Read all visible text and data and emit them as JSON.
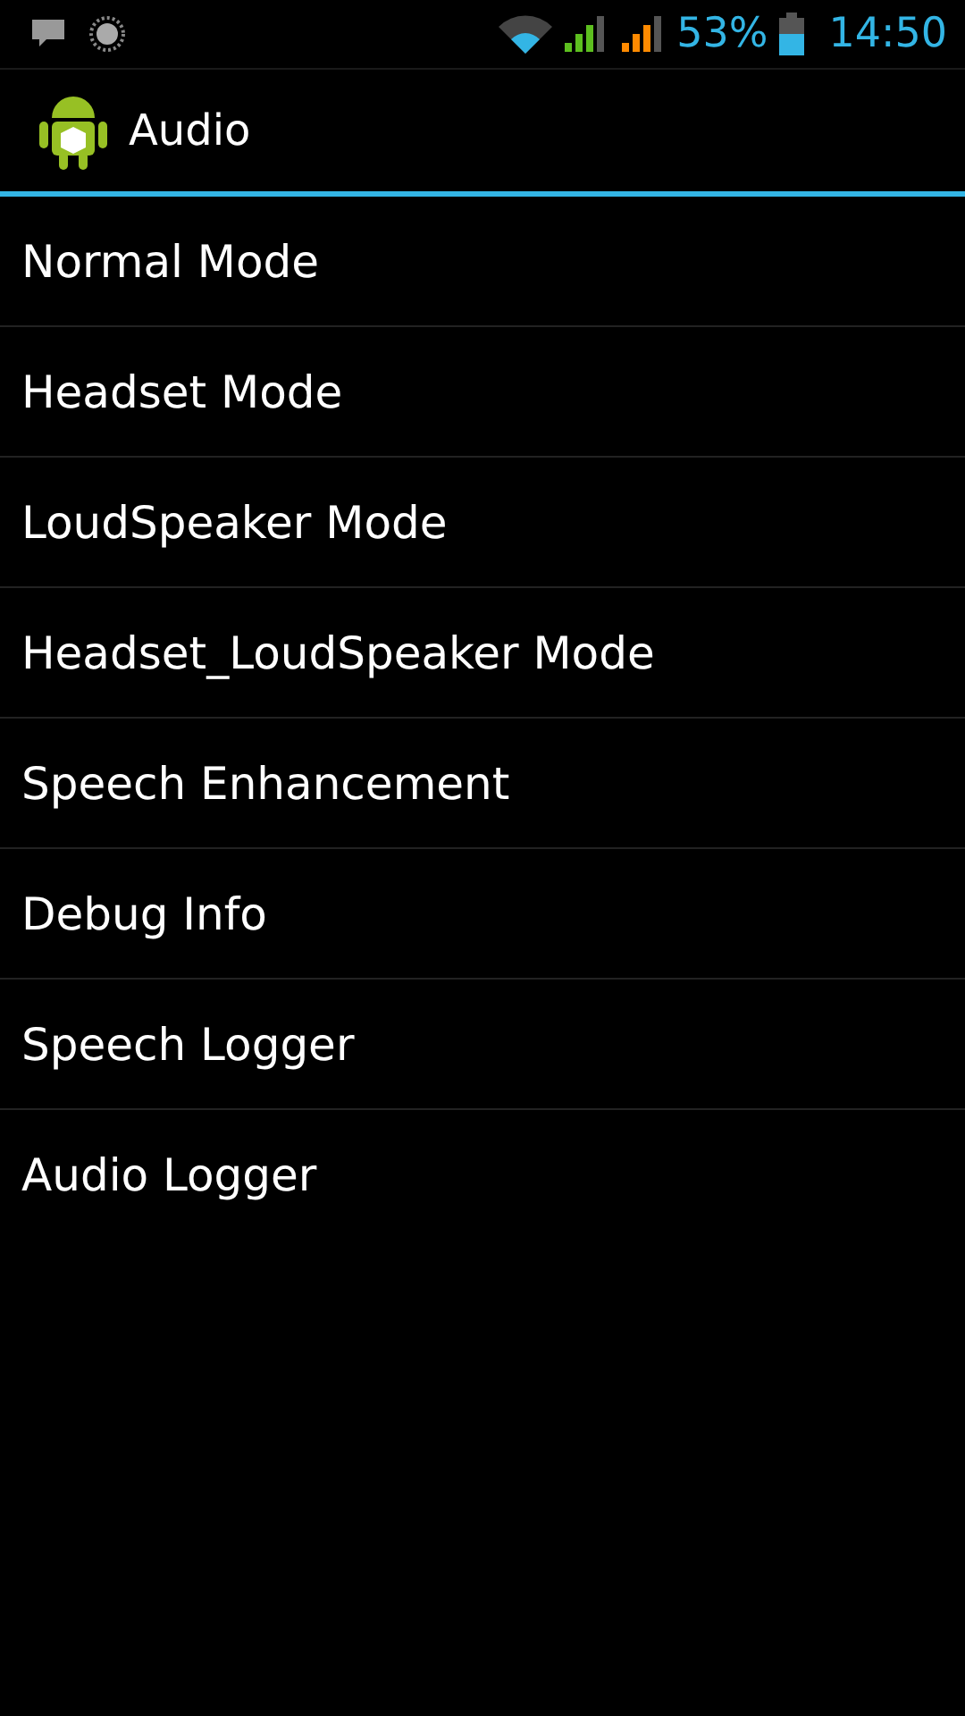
{
  "status_bar": {
    "battery": "53%",
    "time": "14:50"
  },
  "action_bar": {
    "title": "Audio"
  },
  "items": [
    {
      "label": "Normal Mode"
    },
    {
      "label": "Headset Mode"
    },
    {
      "label": "LoudSpeaker Mode"
    },
    {
      "label": "Headset_LoudSpeaker Mode"
    },
    {
      "label": "Speech Enhancement"
    },
    {
      "label": "Debug Info"
    },
    {
      "label": "Speech Logger"
    },
    {
      "label": "Audio Logger"
    }
  ]
}
